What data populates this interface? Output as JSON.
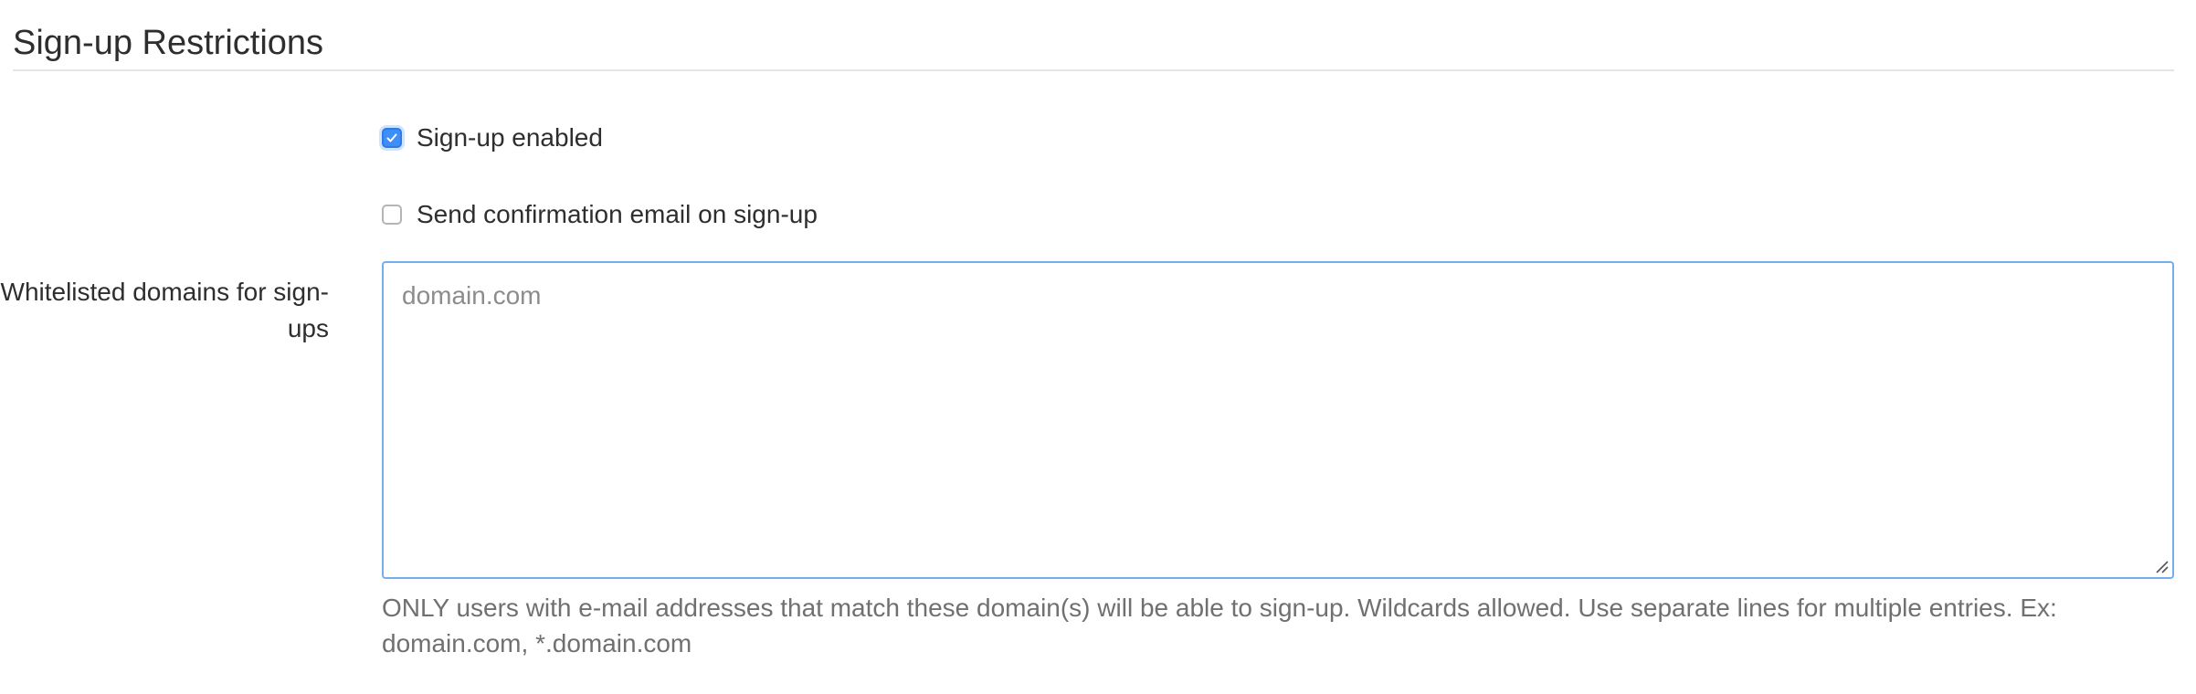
{
  "section": {
    "title": "Sign-up Restrictions"
  },
  "signup_enabled": {
    "label": "Sign-up enabled",
    "checked": true
  },
  "send_confirmation": {
    "label": "Send confirmation email on sign-up",
    "checked": false
  },
  "whitelist": {
    "label": "Whitelisted domains for sign-ups",
    "placeholder": "domain.com",
    "value": "",
    "help": "ONLY users with e-mail addresses that match these domain(s) will be able to sign-up. Wildcards allowed. Use separate lines for multiple entries. Ex: domain.com, *.domain.com"
  },
  "colors": {
    "accent": "#3e8ef7",
    "focus_border": "#73afea",
    "help_text": "#707070",
    "text": "#2e2e2e"
  },
  "icons": {
    "checkmark": "check-icon",
    "resize": "resize-grip-icon"
  }
}
